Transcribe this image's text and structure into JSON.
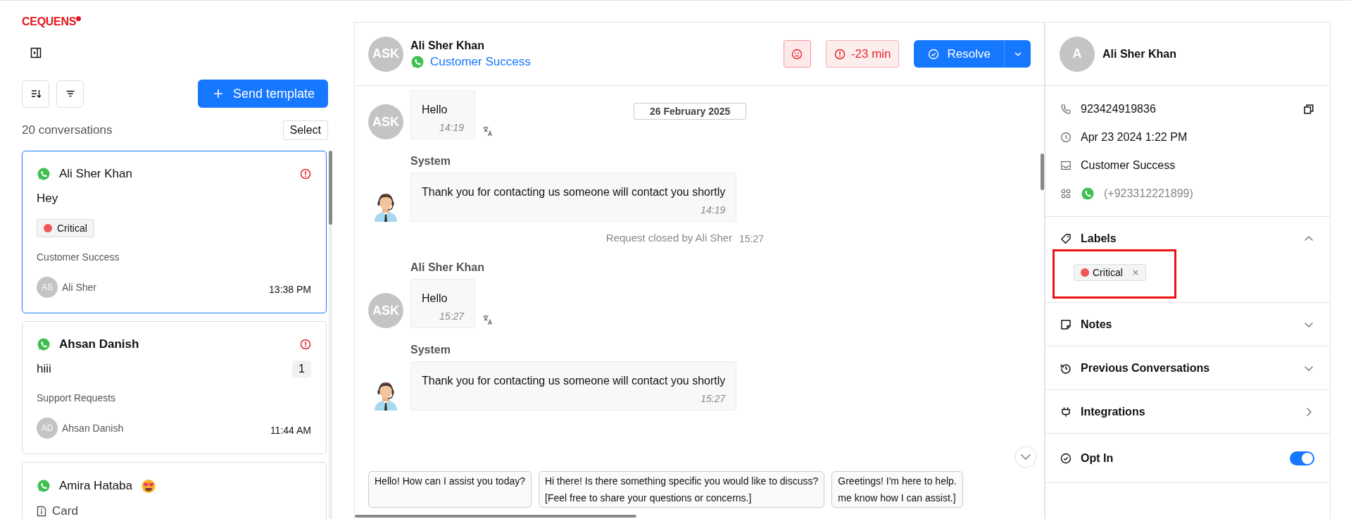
{
  "brand": {
    "logo": "CEQUENS"
  },
  "list_toolbar": {
    "send_template": "Send template"
  },
  "conversation_count": "20 conversations",
  "select_button": "Select",
  "conversations": [
    {
      "name": "Ali Sher Khan",
      "emoji": false,
      "unread": false,
      "overdue": true,
      "selected": true,
      "preview": "Hey",
      "kind": "text",
      "label": {
        "text": "Critical",
        "color": "#f25555"
      },
      "inbox": "Customer Success",
      "agent_initials": "AS",
      "agent": "Ali Sher",
      "time": "13:38 PM"
    },
    {
      "name": "Ahsan Danish",
      "emoji": false,
      "unread": true,
      "overdue": true,
      "selected": false,
      "preview": "hiii",
      "kind": "text",
      "unread_count": "1",
      "inbox": "Support Requests",
      "agent_initials": "AD",
      "agent": "Ahsan Danish",
      "time": "11:44 AM"
    },
    {
      "name": "Amira Hataba",
      "emoji": true,
      "unread": false,
      "overdue": false,
      "selected": false,
      "preview": "Card",
      "kind": "card"
    }
  ],
  "chat_header": {
    "avatar": "ASK",
    "name": "Ali Sher Khan",
    "inbox": "Customer Success",
    "sla": "-23 min",
    "resolve": "Resolve"
  },
  "date_divider": "26 February 2025",
  "messages": [
    {
      "kind": "contact",
      "avatar": "ASK",
      "text": "Hello",
      "time": "14:19"
    },
    {
      "kind": "bot",
      "sender": "System",
      "text": "Thank you for contacting us someone will contact you shortly",
      "time": "14:19"
    },
    {
      "kind": "event",
      "text": "Request closed by Ali Sher",
      "time": "15:27"
    },
    {
      "kind": "contact",
      "sender": "Ali Sher Khan",
      "avatar": "ASK",
      "text": "Hello",
      "time": "15:27"
    },
    {
      "kind": "bot",
      "sender": "System",
      "text": "Thank you for contacting us someone will contact you shortly",
      "time": "15:27"
    }
  ],
  "suggestions": [
    {
      "text": "Hello! How can I assist you today?"
    },
    {
      "text": "Hi there! Is there something specific you would like to discuss?\n[Feel free to share your questions or concerns.]"
    },
    {
      "text": "Greetings! I'm here to help.\nme know how I can assist.]"
    }
  ],
  "contact": {
    "initial": "A",
    "name": "Ali Sher Khan"
  },
  "details": [
    {
      "kind": "phone",
      "text": "923424919836"
    },
    {
      "kind": "created",
      "text": "Apr 23 2024 1:22 PM"
    },
    {
      "kind": "inbox",
      "text": "Customer Success"
    },
    {
      "kind": "channel",
      "text": "(+923312221899)"
    }
  ],
  "sections": [
    {
      "kind": "labels",
      "title": "Labels",
      "expanded": true,
      "highlighted": true,
      "chips": [
        {
          "text": "Critical",
          "color": "#f25555"
        }
      ]
    },
    {
      "kind": "notes",
      "title": "Notes",
      "expanded": false
    },
    {
      "kind": "history",
      "title": "Previous Conversations",
      "expanded": false
    },
    {
      "kind": "integrations",
      "title": "Integrations"
    },
    {
      "kind": "optin",
      "title": "Opt In",
      "on": true
    }
  ]
}
